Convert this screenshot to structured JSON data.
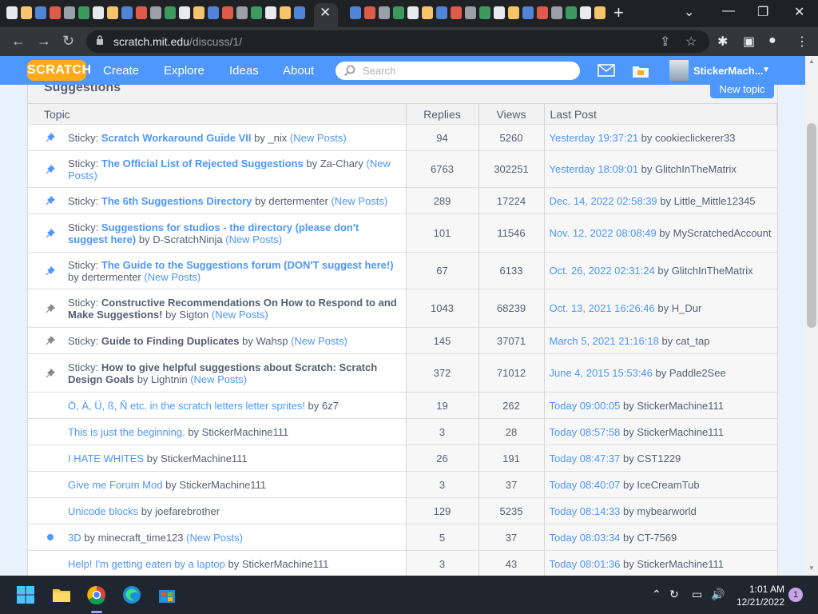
{
  "browser": {
    "tab_count_visible": 42,
    "url_domain": "scratch.mit.edu",
    "url_path": "/discuss/1/"
  },
  "nav": {
    "logo": "SCRATCH",
    "links": [
      "Create",
      "Explore",
      "Ideas",
      "About"
    ],
    "search_placeholder": "Search",
    "username": "StickerMach..."
  },
  "forum": {
    "title": "Suggestions",
    "new_topic": "New topic",
    "columns": [
      "Topic",
      "Replies",
      "Views",
      "Last Post"
    ],
    "rows": [
      {
        "sticky": true,
        "pin": "blue",
        "title": "Scratch Workaround Guide VII",
        "author": "_nix",
        "new_posts": true,
        "replies": "94",
        "views": "5260",
        "last_date": "Yesterday 19:37:21",
        "last_by": "cookieclickerer33"
      },
      {
        "sticky": true,
        "pin": "blue",
        "title": "The Official List of Rejected Suggestions",
        "author": "Za-Chary",
        "new_posts": true,
        "replies": "6763",
        "views": "302251",
        "last_date": "Yesterday 18:09:01",
        "last_by": "GlitchInTheMatrix"
      },
      {
        "sticky": true,
        "pin": "blue",
        "title": "The 6th Suggestions Directory",
        "author": "dertermenter",
        "new_posts": true,
        "replies": "289",
        "views": "17224",
        "last_date": "Dec. 14, 2022 02:58:39",
        "last_by": "Little_Mittle12345"
      },
      {
        "sticky": true,
        "pin": "blue",
        "title": "Suggestions for studios - the directory (please don't suggest here)",
        "author": "D-ScratchNinja",
        "new_posts": true,
        "replies": "101",
        "views": "11546",
        "last_date": "Nov. 12, 2022 08:08:49",
        "last_by": "MyScratchedAccount"
      },
      {
        "sticky": true,
        "pin": "blue",
        "title": "The Guide to the Suggestions forum (DON'T suggest here!)",
        "author": "dertermenter",
        "new_posts": true,
        "replies": "67",
        "views": "6133",
        "last_date": "Oct. 26, 2022 02:31:24",
        "last_by": "GlitchInTheMatrix"
      },
      {
        "sticky": true,
        "pin": "grey",
        "title": "Constructive Recommendations On How to Respond to and Make Suggestions!",
        "author": "Sigton",
        "new_posts": true,
        "replies": "1043",
        "views": "68239",
        "last_date": "Oct. 13, 2021 16:26:46",
        "last_by": "H_Dur"
      },
      {
        "sticky": true,
        "pin": "grey",
        "title": "Guide to Finding Duplicates",
        "author": "Wahsp",
        "new_posts": true,
        "replies": "145",
        "views": "37071",
        "last_date": "March 5, 2021 21:16:18",
        "last_by": "cat_tap"
      },
      {
        "sticky": true,
        "pin": "grey",
        "title": "How to give helpful suggestions about Scratch: Scratch Design Goals",
        "author": "Lightnin",
        "new_posts": true,
        "replies": "372",
        "views": "71012",
        "last_date": "June 4, 2015 15:53:46",
        "last_by": "Paddle2See"
      },
      {
        "sticky": false,
        "pin": "none",
        "title": "Ö, Ä, Ü, ß, Ñ etc. in the scratch letters letter sprites!",
        "author": "6z7",
        "new_posts": false,
        "replies": "19",
        "views": "262",
        "last_date": "Today 09:00:05",
        "last_by": "StickerMachine111"
      },
      {
        "sticky": false,
        "pin": "none",
        "title": "This is just the beginning.",
        "author": "StickerMachine111",
        "new_posts": false,
        "replies": "3",
        "views": "28",
        "last_date": "Today 08:57:58",
        "last_by": "StickerMachine111"
      },
      {
        "sticky": false,
        "pin": "none",
        "title": "I HATE WHITES",
        "author": "StickerMachine111",
        "new_posts": false,
        "replies": "26",
        "views": "191",
        "last_date": "Today 08:47:37",
        "last_by": "CST1229"
      },
      {
        "sticky": false,
        "pin": "none",
        "title": "Give me Forum Mod",
        "author": "StickerMachine111",
        "new_posts": false,
        "replies": "3",
        "views": "37",
        "last_date": "Today 08:40:07",
        "last_by": "IceCreamTub"
      },
      {
        "sticky": false,
        "pin": "none",
        "title": "Unicode blocks",
        "author": "joefarebrother",
        "new_posts": false,
        "replies": "129",
        "views": "5235",
        "last_date": "Today 08:14:33",
        "last_by": "mybearworld"
      },
      {
        "sticky": false,
        "pin": "dot",
        "title": "3D",
        "author": "minecraft_time123",
        "new_posts": true,
        "replies": "5",
        "views": "37",
        "last_date": "Today 08:03:34",
        "last_by": "CT-7569"
      },
      {
        "sticky": false,
        "pin": "none",
        "title": "Help! I'm getting eaten by a laptop",
        "author": "StickerMachine111",
        "new_posts": false,
        "replies": "3",
        "views": "43",
        "last_date": "Today 08:01:36",
        "last_by": "StickerMachine111"
      }
    ],
    "labels": {
      "sticky": "Sticky:",
      "by": "by",
      "new_posts": "(New Posts)"
    }
  },
  "taskbar": {
    "time": "1:01 AM",
    "date": "12/21/2022",
    "notifications": "1"
  },
  "colors": {
    "scratch_blue": "#4d97ff",
    "scratch_orange": "#ffab19",
    "text_grey": "#575e75"
  }
}
